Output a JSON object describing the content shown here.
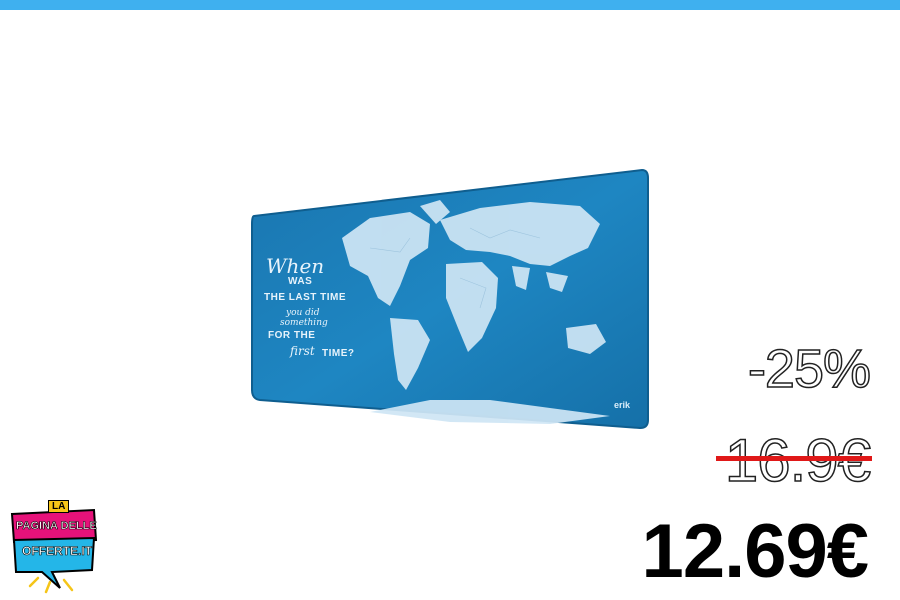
{
  "header": {
    "accent_color": "#3fb0ef"
  },
  "product": {
    "image_icon": "world-map-mousepad",
    "quote": {
      "line1": "When",
      "line2": "WAS",
      "line3": "THE LAST TIME",
      "line4": "you did",
      "line5": "something",
      "line6": "FOR THE",
      "line7": "first",
      "line8": "TIME?"
    },
    "brand": "erik",
    "map_color": "#1e7fb8"
  },
  "pricing": {
    "discount": "-25%",
    "old_price": "16.9€",
    "new_price": "12.69€",
    "strike_color": "#e01818"
  },
  "logo": {
    "la": "LA",
    "line1": "PAGINA DELLE",
    "line2": "OFFERTE.IT",
    "colors": {
      "magenta": "#e6127a",
      "cyan": "#24b6e8",
      "yellow": "#f5c518"
    }
  }
}
